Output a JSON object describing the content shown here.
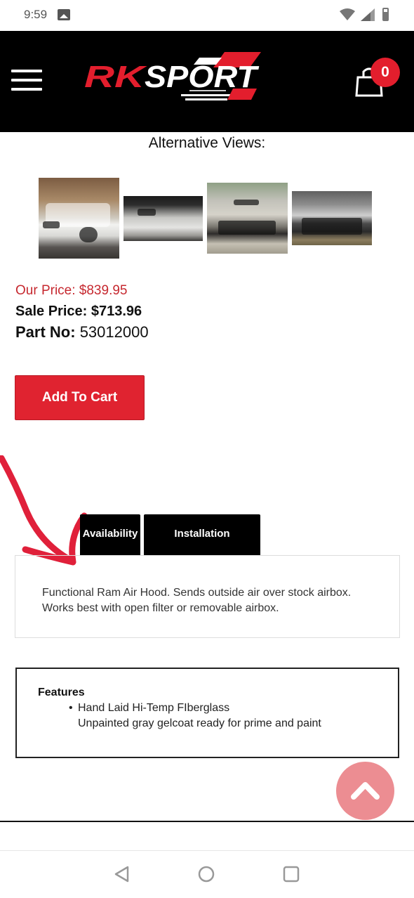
{
  "status_bar": {
    "time": "9:59",
    "icons": [
      "image-icon",
      "wifi-icon",
      "signal-icon",
      "battery-icon"
    ]
  },
  "header": {
    "logo_text": "RKSPORT",
    "menu_icon": "hamburger-menu-icon",
    "cart_icon": "shopping-bag-icon",
    "cart_count": "0",
    "brand_color": "#e31e2d"
  },
  "product": {
    "alt_views_title": "Alternative Views:",
    "thumbnails": [
      "truck-front-view",
      "hood-closeup",
      "hood-front-view",
      "engine-bay-view"
    ],
    "our_price": "Our Price: $839.95",
    "sale_price": "Sale Price: $713.96",
    "part_no_label": "Part No:",
    "part_no_value": "53012000",
    "add_to_cart_label": "Add To Cart"
  },
  "tabs": {
    "items": [
      {
        "label": "Availability"
      },
      {
        "label": "Installation Instructions"
      }
    ]
  },
  "description": {
    "line1": "Functional Ram Air Hood. Sends outside air over stock airbox.",
    "line2": "Works best with open filter or removable airbox."
  },
  "features": {
    "title": "Features",
    "bullet": "•",
    "line1": "Hand Laid Hi-Temp FIberglass",
    "line2": "Unpainted gray gelcoat ready for prime and paint"
  },
  "colors": {
    "price_red": "#c6282f",
    "button_red": "#e02330",
    "scroll_top_pink": "#ec8d92",
    "annotation_red": "#e0203a"
  }
}
